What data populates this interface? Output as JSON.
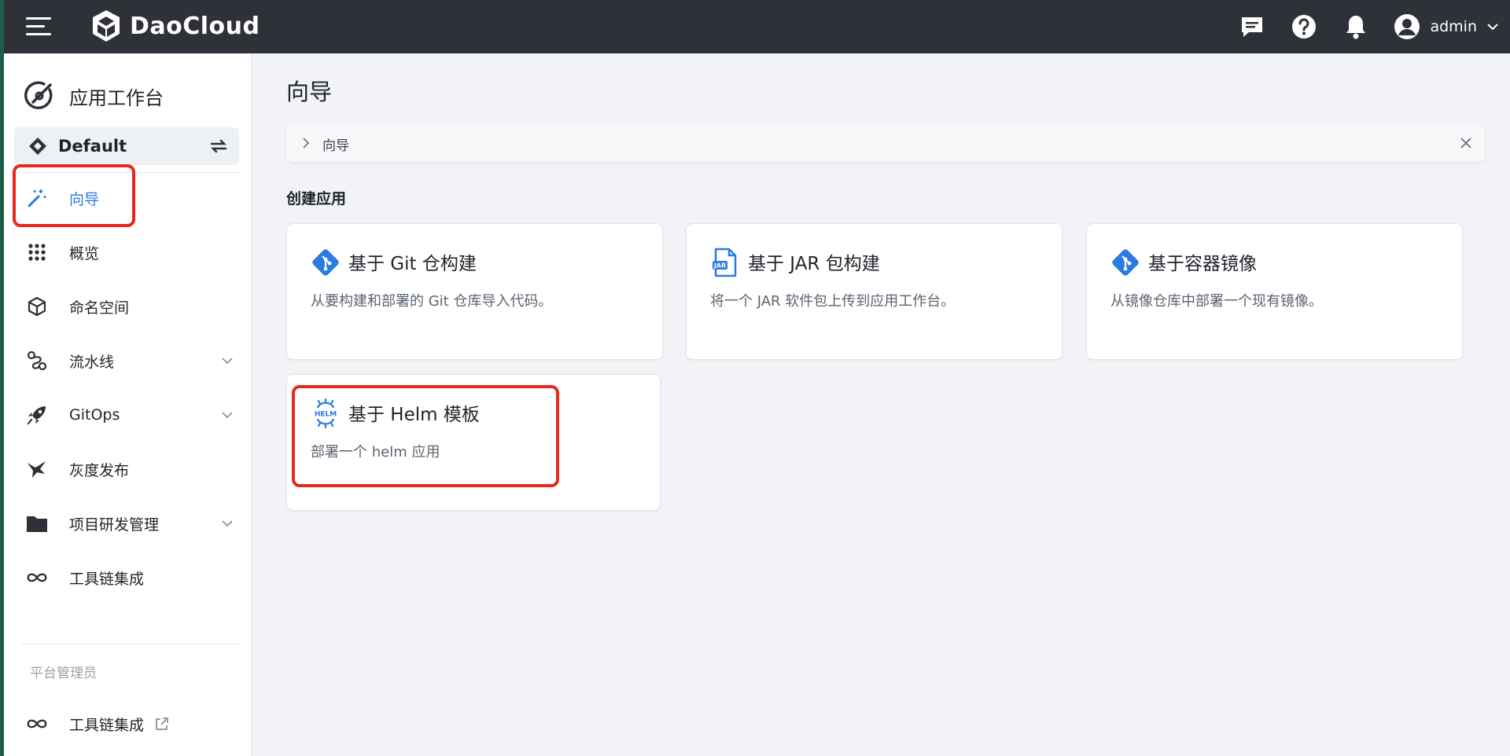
{
  "topbar": {
    "brand_name": "DaoCloud",
    "user_name": "admin",
    "icons": [
      "message-icon",
      "help-icon",
      "bell-icon",
      "user-avatar-icon"
    ]
  },
  "sidebar": {
    "app_title": "应用工作台",
    "workspace": "Default",
    "items": [
      {
        "label": "向导",
        "icon": "magic-wand-icon"
      },
      {
        "label": "概览",
        "icon": "grid-dots-icon"
      },
      {
        "label": "命名空间",
        "icon": "cube-icon"
      },
      {
        "label": "流水线",
        "icon": "pipeline-icon"
      },
      {
        "label": "GitOps",
        "icon": "rocket-icon"
      },
      {
        "label": "灰度发布",
        "icon": "bird-icon"
      },
      {
        "label": "项目研发管理",
        "icon": "folder-icon"
      },
      {
        "label": "工具链集成",
        "icon": "infinity-icon"
      }
    ],
    "section_label": "平台管理员",
    "admin_items": [
      {
        "label": "工具链集成",
        "icon": "infinity-icon"
      }
    ]
  },
  "main": {
    "page_title": "向导",
    "breadcrumb": "向导",
    "section_title": "创建应用",
    "cards": [
      {
        "title": "基于 Git 仓构建",
        "desc": "从要构建和部署的 Git 仓库导入代码。",
        "icon": "git-icon"
      },
      {
        "title": "基于 JAR 包构建",
        "desc": "将一个 JAR 软件包上传到应用工作台。",
        "icon": "jar-file-icon"
      },
      {
        "title": "基于容器镜像",
        "desc": "从镜像仓库中部署一个现有镜像。",
        "icon": "container-image-icon"
      },
      {
        "title": "基于 Helm 模板",
        "desc": "部署一个 helm 应用",
        "icon": "helm-icon"
      }
    ]
  },
  "colors": {
    "topbar_bg": "#2e3138",
    "accent": "#2a7be4",
    "highlight": "#e8271d"
  }
}
